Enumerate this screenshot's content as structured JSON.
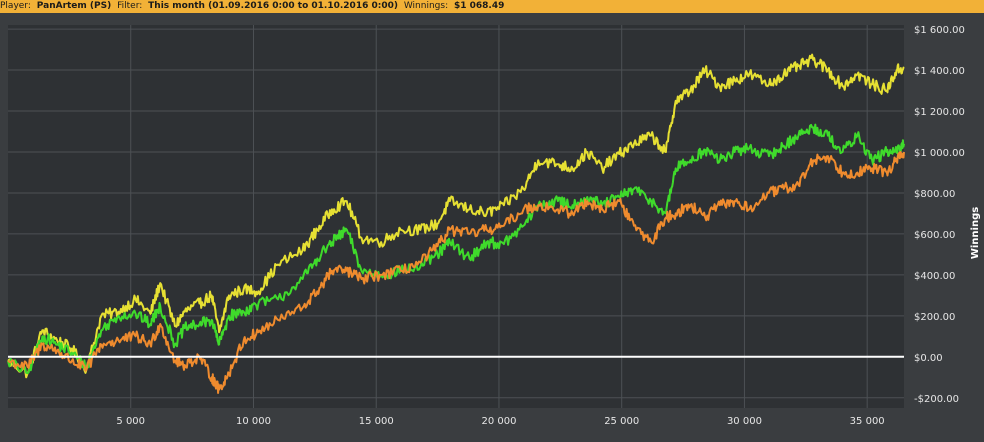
{
  "header": {
    "player_label": "Player:",
    "player_value": "PanArtem (PS)",
    "filter_label": "Filter:",
    "filter_value": "This month (01.09.2016 0:00 to 01.10.2016 0:00)",
    "winnings_label": "Winnings:",
    "winnings_value": "$1 068.49"
  },
  "chart_data": {
    "type": "line",
    "ylabel": "Winnings",
    "xlabel": "",
    "xlim": [
      0,
      36500
    ],
    "ylim": [
      -250,
      1620
    ],
    "grid": true,
    "x_ticks": [
      5000,
      10000,
      15000,
      20000,
      25000,
      30000,
      35000
    ],
    "x_tick_labels": [
      "5 000",
      "10 000",
      "15 000",
      "20 000",
      "25 000",
      "30 000",
      "35 000"
    ],
    "y_ticks": [
      1600,
      1400,
      1200,
      1000,
      800,
      600,
      400,
      200,
      0,
      -200
    ],
    "y_tick_labels": [
      "$1 600.00",
      "$1 400.00",
      "$1 200.00",
      "$1 000.00",
      "$800.00",
      "$600.00",
      "$400.00",
      "$200.00",
      "$0.00",
      "-$200.00"
    ],
    "zero_line_color": "#ffffff",
    "series": [
      {
        "color": "#e6e033",
        "points": [
          [
            0,
            -20
          ],
          [
            800,
            -80
          ],
          [
            1400,
            130
          ],
          [
            2000,
            80
          ],
          [
            2600,
            40
          ],
          [
            3200,
            -60
          ],
          [
            3800,
            200
          ],
          [
            4500,
            220
          ],
          [
            5200,
            280
          ],
          [
            5800,
            210
          ],
          [
            6200,
            360
          ],
          [
            6800,
            150
          ],
          [
            7200,
            220
          ],
          [
            7800,
            260
          ],
          [
            8300,
            300
          ],
          [
            8600,
            120
          ],
          [
            9000,
            300
          ],
          [
            9600,
            330
          ],
          [
            10200,
            320
          ],
          [
            11000,
            450
          ],
          [
            12000,
            520
          ],
          [
            12600,
            620
          ],
          [
            13200,
            720
          ],
          [
            13800,
            760
          ],
          [
            14400,
            580
          ],
          [
            15200,
            560
          ],
          [
            16000,
            620
          ],
          [
            16800,
            620
          ],
          [
            17500,
            650
          ],
          [
            18000,
            760
          ],
          [
            18800,
            720
          ],
          [
            19500,
            700
          ],
          [
            20200,
            740
          ],
          [
            21000,
            820
          ],
          [
            21600,
            960
          ],
          [
            22400,
            940
          ],
          [
            23000,
            920
          ],
          [
            23600,
            1000
          ],
          [
            24200,
            920
          ],
          [
            24900,
            990
          ],
          [
            25500,
            1040
          ],
          [
            26200,
            1080
          ],
          [
            26800,
            1000
          ],
          [
            27200,
            1250
          ],
          [
            27800,
            1300
          ],
          [
            28400,
            1400
          ],
          [
            29000,
            1320
          ],
          [
            29600,
            1350
          ],
          [
            30200,
            1380
          ],
          [
            31000,
            1330
          ],
          [
            31600,
            1380
          ],
          [
            32200,
            1420
          ],
          [
            32800,
            1450
          ],
          [
            33400,
            1400
          ],
          [
            34000,
            1320
          ],
          [
            34600,
            1380
          ],
          [
            35200,
            1330
          ],
          [
            35800,
            1300
          ],
          [
            36200,
            1400
          ],
          [
            36500,
            1410
          ]
        ]
      },
      {
        "color": "#3fda2b",
        "points": [
          [
            0,
            -20
          ],
          [
            800,
            -80
          ],
          [
            1400,
            100
          ],
          [
            2000,
            60
          ],
          [
            2600,
            20
          ],
          [
            3200,
            -50
          ],
          [
            3800,
            130
          ],
          [
            4500,
            200
          ],
          [
            5200,
            210
          ],
          [
            5800,
            160
          ],
          [
            6200,
            250
          ],
          [
            6800,
            60
          ],
          [
            7200,
            140
          ],
          [
            7800,
            160
          ],
          [
            8300,
            180
          ],
          [
            8600,
            60
          ],
          [
            9000,
            200
          ],
          [
            9600,
            220
          ],
          [
            10200,
            260
          ],
          [
            11000,
            280
          ],
          [
            12000,
            380
          ],
          [
            12600,
            480
          ],
          [
            13200,
            560
          ],
          [
            13800,
            620
          ],
          [
            14400,
            420
          ],
          [
            15200,
            400
          ],
          [
            16000,
            420
          ],
          [
            16800,
            440
          ],
          [
            17500,
            500
          ],
          [
            18000,
            560
          ],
          [
            18800,
            480
          ],
          [
            19500,
            560
          ],
          [
            20200,
            550
          ],
          [
            21000,
            640
          ],
          [
            21600,
            740
          ],
          [
            22400,
            760
          ],
          [
            23000,
            740
          ],
          [
            23600,
            780
          ],
          [
            24200,
            740
          ],
          [
            24900,
            780
          ],
          [
            25500,
            820
          ],
          [
            26200,
            760
          ],
          [
            26800,
            700
          ],
          [
            27200,
            920
          ],
          [
            27800,
            960
          ],
          [
            28400,
            1010
          ],
          [
            29000,
            960
          ],
          [
            29600,
            1000
          ],
          [
            30200,
            1020
          ],
          [
            31000,
            980
          ],
          [
            31600,
            1030
          ],
          [
            32200,
            1080
          ],
          [
            32800,
            1120
          ],
          [
            33400,
            1080
          ],
          [
            34000,
            1000
          ],
          [
            34600,
            1080
          ],
          [
            35200,
            960
          ],
          [
            35800,
            1000
          ],
          [
            36200,
            1000
          ],
          [
            36500,
            1040
          ]
        ]
      },
      {
        "color": "#ef8b2e",
        "points": [
          [
            0,
            -20
          ],
          [
            800,
            -50
          ],
          [
            1400,
            60
          ],
          [
            2000,
            30
          ],
          [
            2600,
            -20
          ],
          [
            3200,
            -60
          ],
          [
            3800,
            60
          ],
          [
            4500,
            80
          ],
          [
            5200,
            100
          ],
          [
            5800,
            60
          ],
          [
            6200,
            160
          ],
          [
            6800,
            -20
          ],
          [
            7200,
            -40
          ],
          [
            7800,
            0
          ],
          [
            8300,
            -100
          ],
          [
            8600,
            -160
          ],
          [
            9000,
            -80
          ],
          [
            9600,
            80
          ],
          [
            10200,
            120
          ],
          [
            11000,
            180
          ],
          [
            12000,
            240
          ],
          [
            12600,
            320
          ],
          [
            13200,
            420
          ],
          [
            13800,
            420
          ],
          [
            14400,
            380
          ],
          [
            15200,
            400
          ],
          [
            16000,
            420
          ],
          [
            16800,
            460
          ],
          [
            17500,
            540
          ],
          [
            18000,
            620
          ],
          [
            18800,
            600
          ],
          [
            19500,
            620
          ],
          [
            20200,
            640
          ],
          [
            21000,
            720
          ],
          [
            21600,
            740
          ],
          [
            22400,
            720
          ],
          [
            23000,
            700
          ],
          [
            23600,
            760
          ],
          [
            24200,
            720
          ],
          [
            24900,
            760
          ],
          [
            25500,
            640
          ],
          [
            26200,
            560
          ],
          [
            26800,
            680
          ],
          [
            27200,
            700
          ],
          [
            27800,
            740
          ],
          [
            28400,
            680
          ],
          [
            29000,
            740
          ],
          [
            29600,
            760
          ],
          [
            30200,
            720
          ],
          [
            31000,
            800
          ],
          [
            31600,
            820
          ],
          [
            32200,
            840
          ],
          [
            32800,
            960
          ],
          [
            33400,
            980
          ],
          [
            34000,
            900
          ],
          [
            34600,
            900
          ],
          [
            35200,
            920
          ],
          [
            35800,
            900
          ],
          [
            36200,
            960
          ],
          [
            36500,
            1000
          ]
        ]
      }
    ]
  }
}
